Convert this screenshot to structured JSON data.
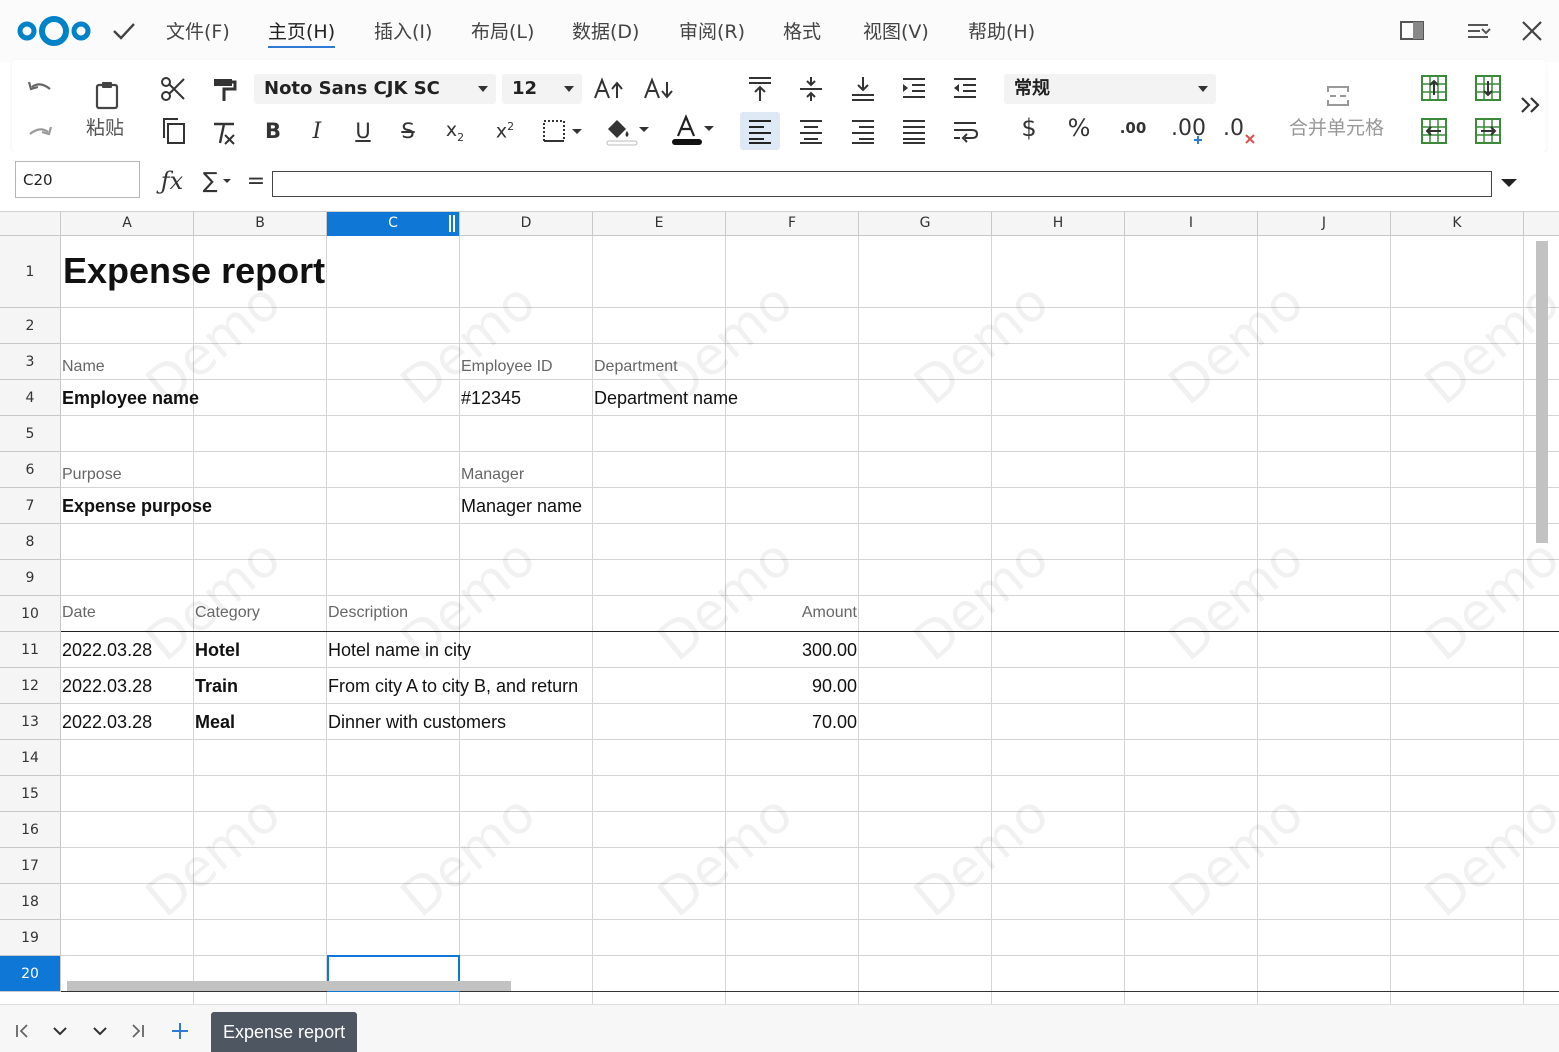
{
  "menubar": {
    "items": [
      "文件(F)",
      "主页(H)",
      "插入(I)",
      "布局(L)",
      "数据(D)",
      "审阅(R)",
      "格式",
      "视图(V)",
      "帮助(H)"
    ],
    "active_index": 1
  },
  "toolbar": {
    "paste_label": "粘贴",
    "font_name": "Noto Sans CJK SC",
    "font_size": "12",
    "number_format": "常规",
    "merge_label": "合并单元格",
    "decimal_label": ".00"
  },
  "formula": {
    "cell_ref": "C20",
    "equals": "=",
    "value": ""
  },
  "grid": {
    "columns": [
      "A",
      "B",
      "C",
      "D",
      "E",
      "F",
      "G",
      "H",
      "I",
      "J",
      "K"
    ],
    "selected_column": "C",
    "rows": [
      "1",
      "2",
      "3",
      "4",
      "5",
      "6",
      "7",
      "8",
      "9",
      "10",
      "11",
      "12",
      "13",
      "14",
      "15",
      "16",
      "17",
      "18",
      "19",
      "20"
    ],
    "selected_row": "20",
    "watermark": "Demo"
  },
  "sheet": {
    "title": "Expense report",
    "name_label": "Name",
    "name_value": "Employee name",
    "employee_id_label": "Employee ID",
    "employee_id_value": "#12345",
    "department_label": "Department",
    "department_value": "Department name",
    "purpose_label": "Purpose",
    "purpose_value": "Expense purpose",
    "manager_label": "Manager",
    "manager_value": "Manager name",
    "headers": {
      "date": "Date",
      "category": "Category",
      "description": "Description",
      "amount": "Amount"
    },
    "items": [
      {
        "date": "2022.03.28",
        "category": "Hotel",
        "description": "Hotel name in city",
        "amount": "300.00"
      },
      {
        "date": "2022.03.28",
        "category": "Train",
        "description": "From city A to city B, and return",
        "amount": "90.00"
      },
      {
        "date": "2022.03.28",
        "category": "Meal",
        "description": "Dinner with customers",
        "amount": "70.00"
      }
    ]
  },
  "tabs": {
    "active": "Expense report"
  },
  "colors": {
    "accent": "#0f78d7",
    "logo": "#0082c9",
    "tab": "#4e5661"
  }
}
